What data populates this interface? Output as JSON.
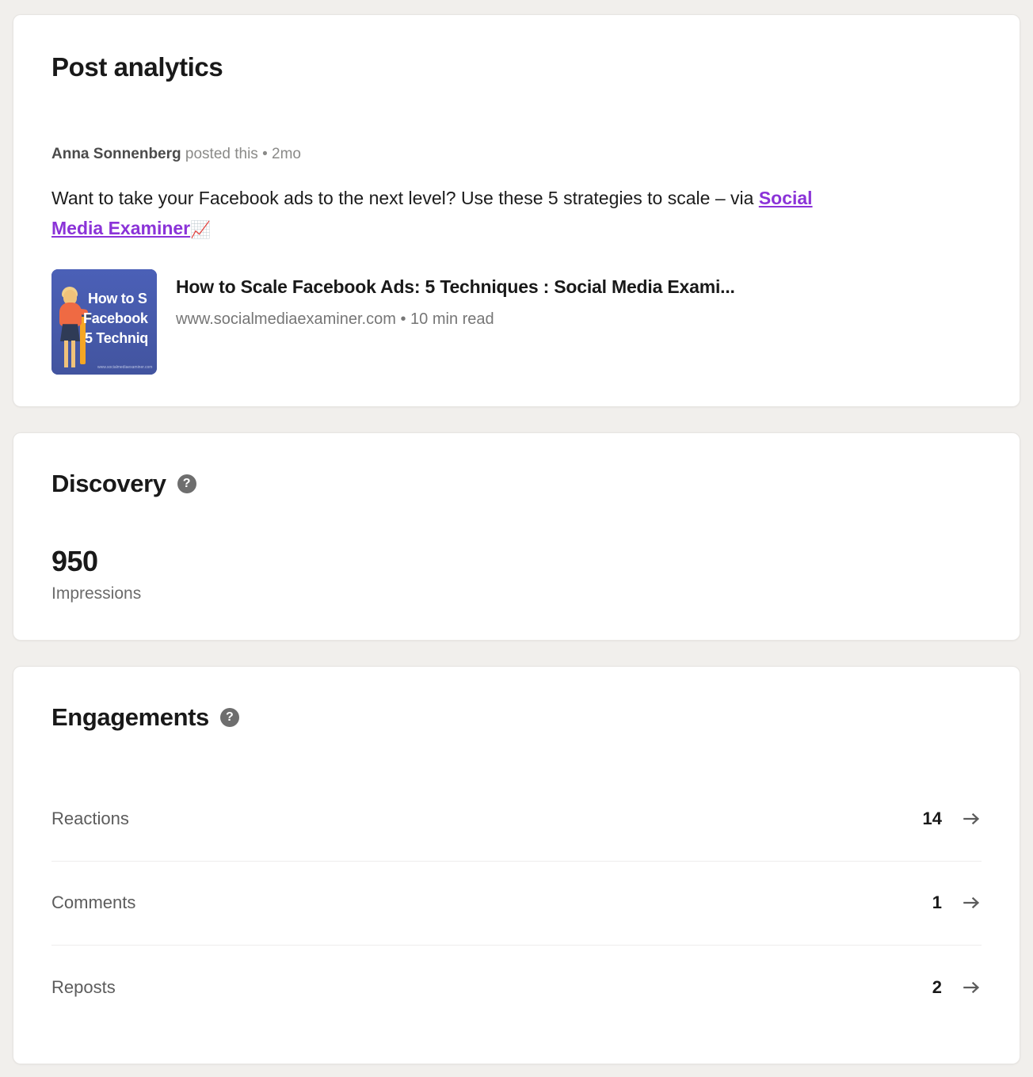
{
  "page": {
    "title": "Post analytics",
    "background_color": "#f1efec",
    "card_color": "#ffffff"
  },
  "post": {
    "author": "Anna Sonnenberg",
    "byline_suffix": " posted this  •  2mo",
    "text_part1": "Want to take your Facebook ads to the next level? Use these 5 strategies to scale – via ",
    "link_text": "Social Media Examiner",
    "emoji": "📈",
    "link_color": "#8b33d8",
    "preview": {
      "title": "How to Scale Facebook Ads: 5 Techniques : Social Media Exami...",
      "url": "www.socialmediaexaminer.com",
      "read_time": "10 min read",
      "separator": "•",
      "thumbnail": {
        "line1": "How to S",
        "line2": "Facebook",
        "line3": "5 Techniq",
        "footer_url": "www.socialmediaexaminer.com",
        "background_color": "#4a5fb5"
      }
    }
  },
  "discovery": {
    "title": "Discovery",
    "help_icon": "help-circle-icon",
    "metric_value": "950",
    "metric_label": "Impressions"
  },
  "engagements": {
    "title": "Engagements",
    "help_icon": "help-circle-icon",
    "rows": [
      {
        "label": "Reactions",
        "value": "14",
        "arrow": "arrow-right-icon"
      },
      {
        "label": "Comments",
        "value": "1",
        "arrow": "arrow-right-icon"
      },
      {
        "label": "Reposts",
        "value": "2",
        "arrow": "arrow-right-icon"
      }
    ]
  }
}
